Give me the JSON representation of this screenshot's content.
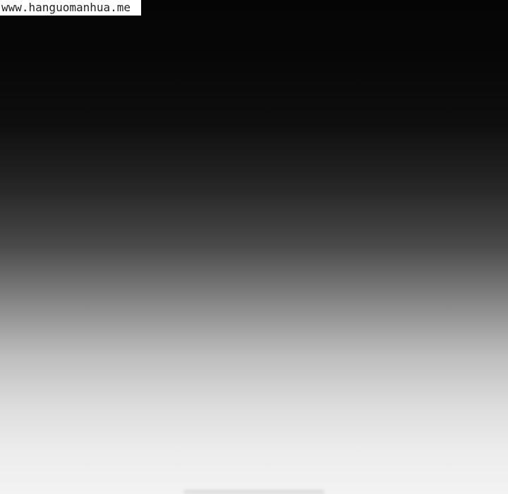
{
  "watermark": {
    "text": "www.hanguomanhua.me"
  },
  "colors": {
    "top": "#050505",
    "middle": "#4a4a4a",
    "bottom": "#f3f3f3",
    "watermark_bg": "#ffffff",
    "watermark_text": "#222222"
  }
}
